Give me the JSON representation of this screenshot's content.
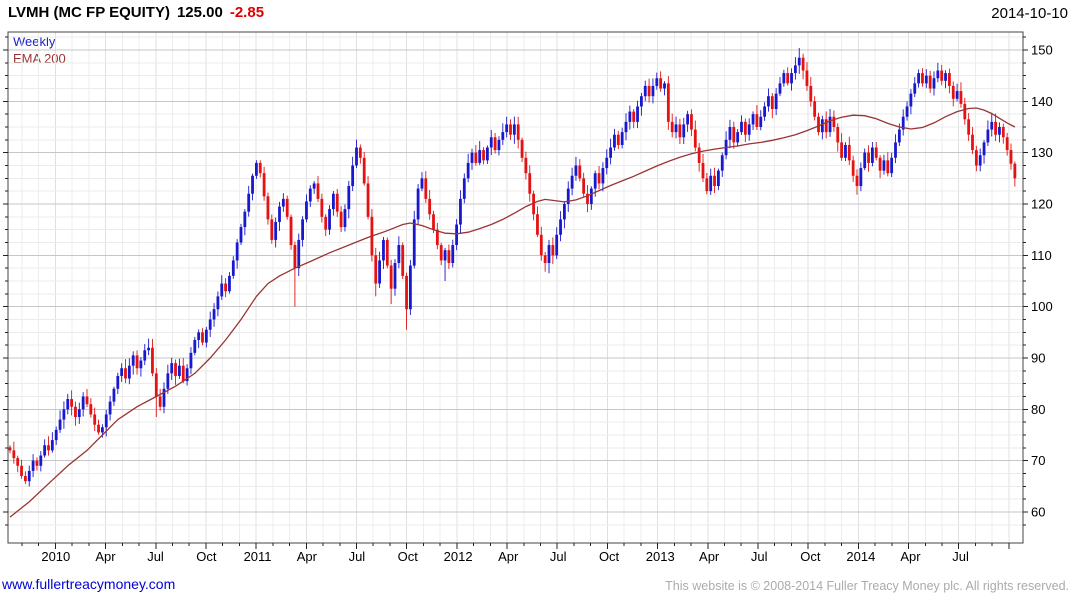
{
  "header": {
    "title": "LVMH (MC FP EQUITY)",
    "last_price": "125.00",
    "change": "-2.85",
    "date": "2014-10-10"
  },
  "legend": [
    {
      "label": "Weekly",
      "color": "#2121c8"
    },
    {
      "label": "EMA 200",
      "color": "#9b3434"
    }
  ],
  "footer": {
    "site_link": "www.fullertreacymoney.com",
    "copyright": "This website is © 2008-2014 Fuller Treacy Money plc. All rights reserved."
  },
  "chart_data": {
    "type": "candlestick",
    "title": "LVMH (MC FP EQUITY)",
    "interval": "Weekly",
    "overlay": "EMA 200",
    "last_close": 125.0,
    "change": -2.85,
    "grid": true,
    "legend_position": "top-left",
    "y_axis_side": "right",
    "y_ticks": [
      60,
      70,
      80,
      90,
      100,
      110,
      120,
      130,
      140,
      150
    ],
    "y_minor_step": 2.5,
    "y_range": [
      54,
      153.5
    ],
    "x_labels": [
      [
        "2010",
        11.9
      ],
      [
        "Apr",
        24.8
      ],
      [
        "Jul",
        37.8
      ],
      [
        "Oct",
        51.0
      ],
      [
        "2011",
        64.3
      ],
      [
        "Apr",
        77.1
      ],
      [
        "Jul",
        90.1
      ],
      [
        "Oct",
        103.3
      ],
      [
        "2012",
        116.4
      ],
      [
        "Apr",
        129.4
      ],
      [
        "Jul",
        142.4
      ],
      [
        "Oct",
        155.6
      ],
      [
        "2013",
        168.9
      ],
      [
        "Apr",
        181.6
      ],
      [
        "Jul",
        194.6
      ],
      [
        "Oct",
        207.9
      ],
      [
        "2014",
        221.0
      ],
      [
        "Apr",
        233.9
      ],
      [
        "Jul",
        246.9
      ]
    ],
    "weeks_total": 262,
    "first_week_date": "2009-10-10",
    "closes": [
      72,
      70.5,
      69,
      67,
      66,
      68,
      70,
      69,
      71,
      73,
      72,
      74,
      76,
      78,
      80,
      82,
      80.5,
      78.5,
      80,
      82.5,
      81,
      79,
      77,
      75.5,
      76.5,
      79,
      81.5,
      84,
      86.5,
      88,
      86,
      88.5,
      90.5,
      88,
      89.5,
      91.5,
      92,
      87,
      82.5,
      80.5,
      84,
      87,
      89,
      86.5,
      88.5,
      85.5,
      88,
      91,
      93.5,
      95,
      93,
      95.5,
      97.5,
      99.5,
      102,
      104.5,
      103,
      106,
      109,
      112.5,
      115.5,
      118.5,
      122,
      125.5,
      128,
      126,
      121.5,
      117,
      113,
      116.5,
      119.5,
      121,
      117.5,
      112,
      107.5,
      113,
      117,
      120.5,
      123,
      124,
      121,
      117.5,
      115,
      119,
      122,
      118.5,
      115.5,
      119,
      123.5,
      127.5,
      131,
      129,
      124,
      117.5,
      110,
      104.5,
      109,
      113,
      108,
      103.5,
      108.5,
      112,
      106,
      99.5,
      108,
      117,
      123,
      125,
      121,
      118,
      115,
      112,
      109,
      111,
      108.5,
      112,
      116,
      121,
      125,
      128,
      130,
      128,
      130.5,
      128.5,
      131,
      133,
      130.5,
      132.5,
      134,
      135.5,
      133.5,
      135.5,
      132.5,
      129,
      126,
      122,
      118,
      114,
      110,
      108.5,
      112,
      110,
      114,
      117,
      120,
      123,
      125.5,
      127.5,
      125,
      122,
      120,
      123,
      126,
      124,
      127,
      129,
      131,
      133.5,
      131.5,
      134,
      136,
      138,
      136,
      139,
      141,
      143,
      141,
      143,
      144.5,
      142.5,
      143.5,
      136,
      134,
      135.5,
      133,
      135.5,
      137.5,
      134.5,
      131,
      128,
      125,
      122.5,
      125.5,
      123.5,
      126.5,
      129.5,
      132.5,
      135,
      132,
      134,
      136,
      133.5,
      135.5,
      137.5,
      135,
      137,
      139,
      141,
      138.5,
      141.5,
      143.5,
      145.5,
      143.5,
      145.5,
      147,
      148.5,
      146,
      143,
      140,
      137,
      134,
      136.5,
      134,
      137,
      135,
      132,
      129,
      131.5,
      128.5,
      125.5,
      123.5,
      127,
      130,
      128,
      131,
      129,
      126.5,
      128.5,
      126,
      129,
      132,
      134.5,
      137,
      139,
      141.5,
      143.5,
      145.5,
      143.5,
      145,
      142.5,
      144.5,
      146,
      144,
      145.5,
      143,
      140.5,
      142,
      139.5,
      136.5,
      133.5,
      130.5,
      127.5,
      129.5,
      132,
      134.5,
      136,
      133.5,
      135,
      133,
      130.5,
      127.85,
      125
    ],
    "spikes": {
      "38": {
        "low": 78.5
      },
      "74": {
        "low": 100
      },
      "95": {
        "low": 102
      },
      "99": {
        "low": 100.5
      },
      "103": {
        "low": 95.5
      },
      "113": {
        "low": 105
      },
      "129": {
        "high": 137
      },
      "140": {
        "low": 106.5
      },
      "205": {
        "high": 150.4
      },
      "220": {
        "low": 121.8
      },
      "241": {
        "high": 147.5
      }
    },
    "ema": [
      [
        0,
        59
      ],
      [
        5,
        62
      ],
      [
        10,
        65.5
      ],
      [
        15,
        69
      ],
      [
        20,
        72
      ],
      [
        24,
        75
      ],
      [
        28,
        78
      ],
      [
        33,
        80.5
      ],
      [
        38,
        82.5
      ],
      [
        43,
        84.5
      ],
      [
        48,
        87
      ],
      [
        52,
        90
      ],
      [
        56,
        93.5
      ],
      [
        60,
        97.5
      ],
      [
        64,
        102
      ],
      [
        67,
        104.5
      ],
      [
        70,
        106
      ],
      [
        74,
        107.5
      ],
      [
        78,
        108.8
      ],
      [
        83,
        110.5
      ],
      [
        88,
        112
      ],
      [
        93,
        113.5
      ],
      [
        98,
        114.8
      ],
      [
        102,
        116
      ],
      [
        104,
        116.3
      ],
      [
        107,
        115.8
      ],
      [
        110,
        115
      ],
      [
        113,
        114.3
      ],
      [
        116,
        114.2
      ],
      [
        119,
        114.5
      ],
      [
        122,
        115.2
      ],
      [
        125,
        116
      ],
      [
        128,
        117
      ],
      [
        131,
        118.2
      ],
      [
        134,
        119.5
      ],
      [
        137,
        120.5
      ],
      [
        139,
        120.9
      ],
      [
        141,
        120.7
      ],
      [
        144,
        120.4
      ],
      [
        147,
        120.8
      ],
      [
        150,
        121.6
      ],
      [
        153,
        122.6
      ],
      [
        156,
        123.6
      ],
      [
        159,
        124.5
      ],
      [
        162,
        125.4
      ],
      [
        165,
        126.4
      ],
      [
        168,
        127.4
      ],
      [
        171,
        128.3
      ],
      [
        174,
        129.1
      ],
      [
        177,
        129.8
      ],
      [
        180,
        130.3
      ],
      [
        183,
        130.7
      ],
      [
        186,
        131
      ],
      [
        189,
        131.3
      ],
      [
        192,
        131.7
      ],
      [
        195,
        132
      ],
      [
        198,
        132.4
      ],
      [
        201,
        132.9
      ],
      [
        204,
        133.5
      ],
      [
        207,
        134.3
      ],
      [
        210,
        135.2
      ],
      [
        213,
        136.2
      ],
      [
        216,
        136.9
      ],
      [
        219,
        137.3
      ],
      [
        222,
        137.2
      ],
      [
        225,
        136.6
      ],
      [
        228,
        135.7
      ],
      [
        231,
        135
      ],
      [
        234,
        134.6
      ],
      [
        237,
        134.9
      ],
      [
        240,
        135.8
      ],
      [
        243,
        137
      ],
      [
        246,
        138
      ],
      [
        249,
        138.6
      ],
      [
        251,
        138.7
      ],
      [
        253,
        138.3
      ],
      [
        255,
        137.6
      ],
      [
        257,
        136.7
      ],
      [
        259,
        135.8
      ],
      [
        261,
        135
      ]
    ],
    "colors": {
      "up": "#1818cf",
      "down": "#e41212",
      "ema": "#9a3434",
      "grid_minor": "#ebebeb",
      "grid_major": "#c6c6c6",
      "grid_vertical": "#ededed",
      "grid_vertical_quarter": "#e0e0e0",
      "border": "#444444",
      "tick": "#222222",
      "label": "#000000"
    }
  }
}
